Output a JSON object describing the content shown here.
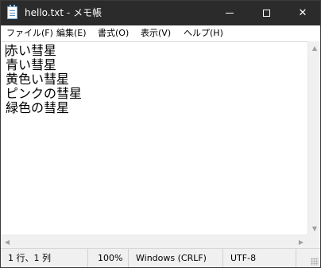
{
  "window": {
    "title": "hello.txt - メモ帳",
    "controls": {
      "minimize_icon": "minimize-icon",
      "maximize_icon": "maximize-icon",
      "close_symbol": "✕"
    }
  },
  "menu": {
    "items": [
      {
        "label": "ファイル(F)"
      },
      {
        "label": "編集(E)"
      },
      {
        "label": "書式(O)"
      },
      {
        "label": "表示(V)"
      },
      {
        "label": "ヘルプ(H)"
      }
    ]
  },
  "document": {
    "lines": [
      "赤い彗星",
      "青い彗星",
      "黄色い彗星",
      "ピンクの彗星",
      "緑色の彗星"
    ]
  },
  "scrollbars": {
    "up_arrow": "▲",
    "down_arrow": "▼",
    "left_arrow": "◀",
    "right_arrow": "▶"
  },
  "status": {
    "position": "1 行、1 列",
    "zoom": "100%",
    "line_ending": "Windows (CRLF)",
    "encoding": "UTF-8"
  },
  "colors": {
    "titlebar": "#2b2b2b",
    "title_text": "#ffffff",
    "editor_bg": "#ffffff",
    "chrome_bg": "#f0f0f0"
  }
}
